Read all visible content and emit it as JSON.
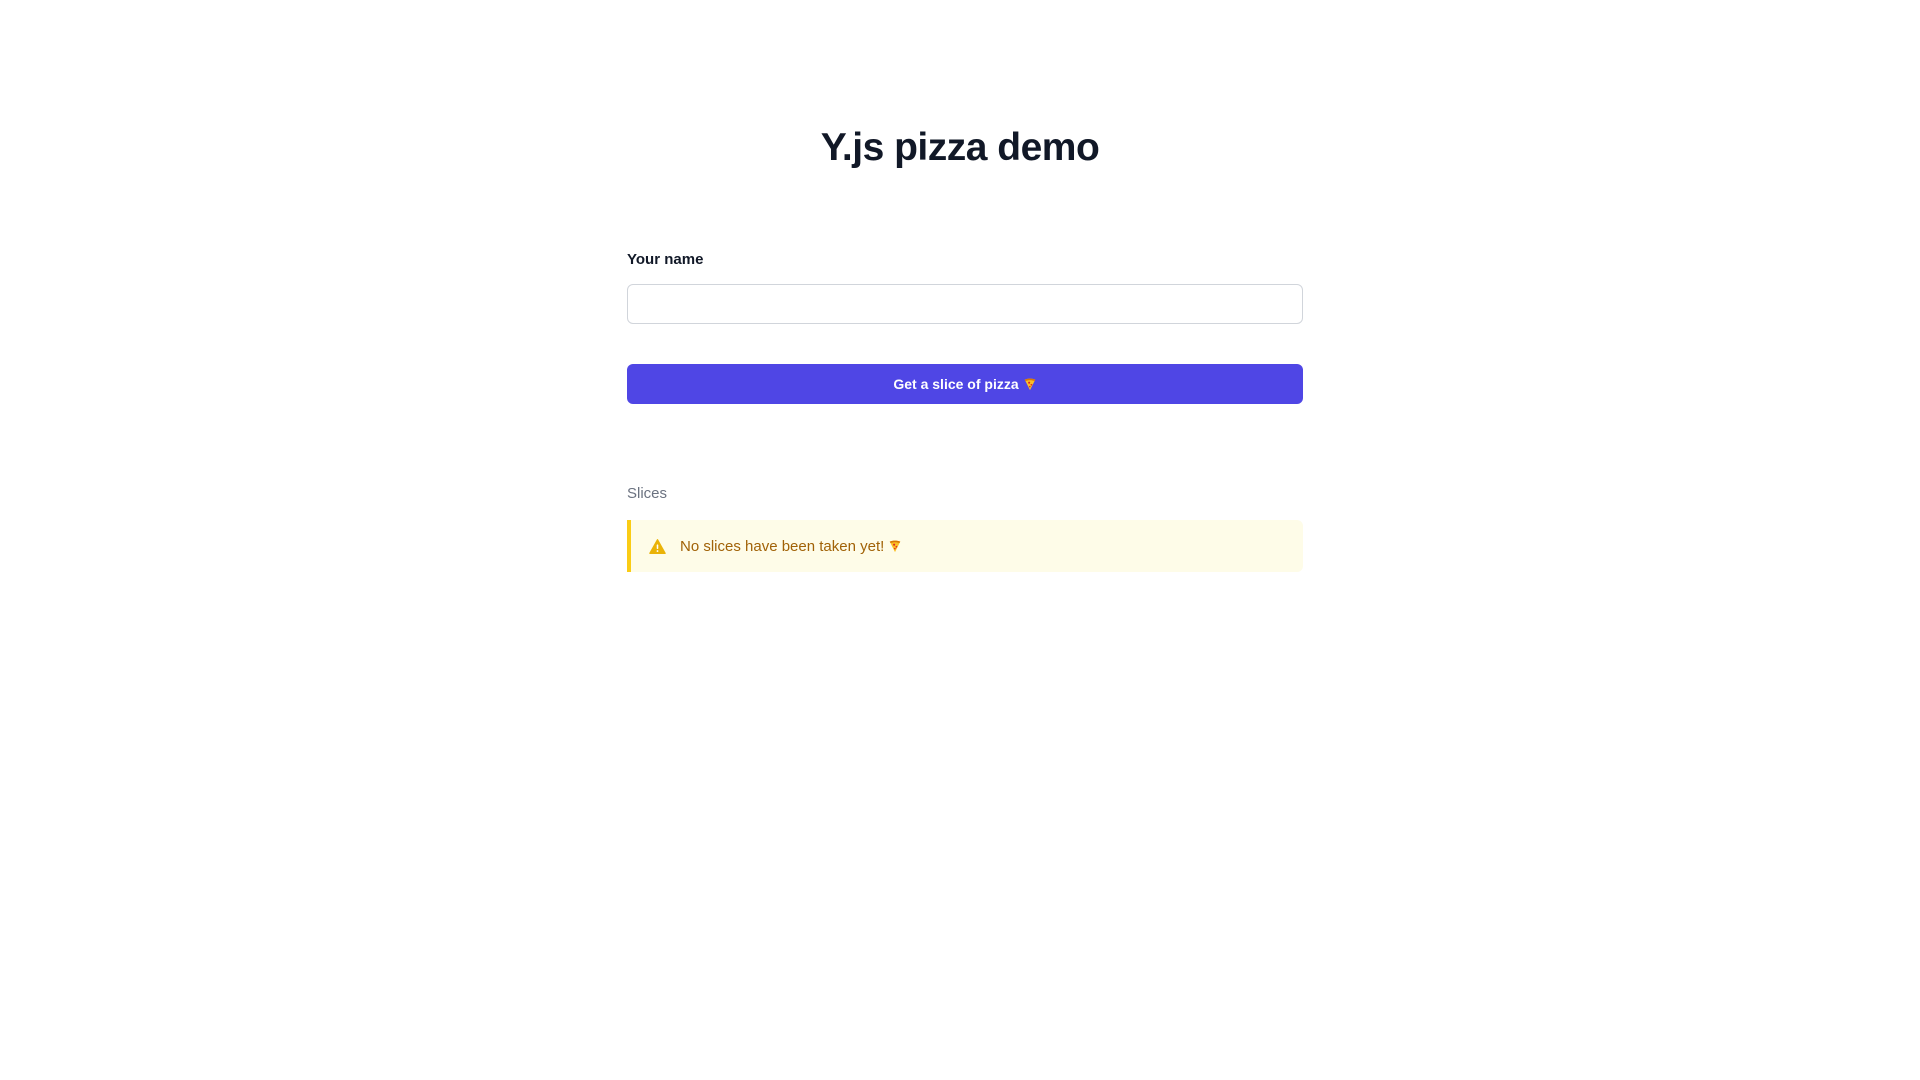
{
  "page": {
    "title": "Y.js pizza demo"
  },
  "form": {
    "name_label": "Your name",
    "name_value": "",
    "name_placeholder": "",
    "submit_label": "Get a slice of pizza",
    "submit_icon": "pizza-icon"
  },
  "slices": {
    "heading": "Slices",
    "empty_message": "No slices have been taken yet!",
    "empty_icon": "warning-icon",
    "empty_trailing_icon": "pizza-icon"
  },
  "colors": {
    "accent": "#4f46e5",
    "warning_border": "#facc15",
    "warning_bg": "#fefce8",
    "warning_text": "#a16207",
    "warning_icon": "#eab308"
  }
}
